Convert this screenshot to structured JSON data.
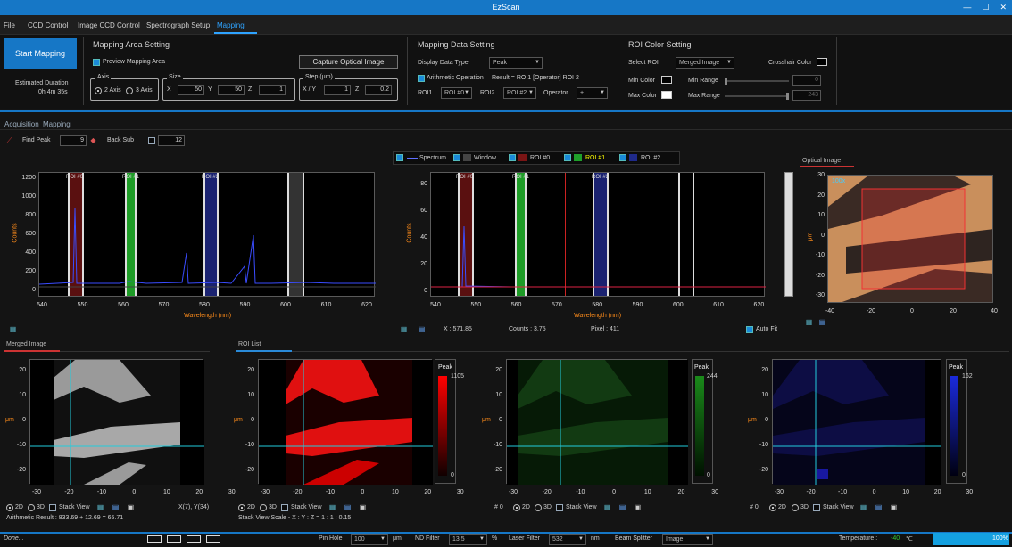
{
  "app": {
    "title": "EzScan",
    "win": {
      "min": "—",
      "max": "☐",
      "close": "✕"
    }
  },
  "menu": [
    "File",
    "CCD Control",
    "Image CCD Control",
    "Spectrograph Setup",
    "Mapping"
  ],
  "ribbon": {
    "start": "Start Mapping",
    "est_label": "Estimated Duration",
    "est_value": "0h 4m 35s",
    "area": {
      "title": "Mapping Area Setting",
      "preview": "Preview Mapping Area",
      "capture": "Capture Optical Image",
      "axis": "Axis",
      "two": "2 Axis",
      "three": "3 Axis",
      "size": "Size",
      "x": "X",
      "y": "Y",
      "z": "Z",
      "sx": "50",
      "sy": "50",
      "sz": "1",
      "step": "Step (μm)",
      "xy": "X / Y",
      "stxy": "1",
      "stz": "0.2"
    },
    "data": {
      "title": "Mapping Data Setting",
      "type_label": "Display Data Type",
      "type": "Peak",
      "arith": "Arithmetic Operation",
      "result": "Result = ROI1 [Operator] ROI 2",
      "roi1": "ROI1",
      "roi1v": "ROI #0",
      "roi2": "ROI2",
      "roi2v": "ROI #2",
      "op": "Operator",
      "opv": "+"
    },
    "color": {
      "title": "ROI Color Setting",
      "sel": "Select ROI",
      "selv": "Merged Image",
      "cross": "Crosshair Color",
      "min": "Min Color",
      "max": "Max Color",
      "minr": "Min Range",
      "minv": "0",
      "maxr": "Max Range",
      "maxv": "243"
    }
  },
  "tabs": {
    "acq": "Acquisition",
    "map": "Mapping"
  },
  "findpeak": {
    "label": "Find Peak",
    "value": "9",
    "back": "Back Sub",
    "back_value": "12"
  },
  "legend": [
    "Spectrum",
    "Window",
    "ROI #0",
    "ROI #1",
    "ROI #2"
  ],
  "colors": {
    "roi0": "#7a1515",
    "roi1": "#1fa02a",
    "roi2": "#1f2a8a",
    "accent": "#1677c6"
  },
  "spec": {
    "y_title": "Counts",
    "x_title": "Wavelength (nm)",
    "yticks": [
      "1200",
      "1000",
      "800",
      "600",
      "400",
      "200",
      "0"
    ],
    "xticks": [
      "540",
      "550",
      "560",
      "570",
      "580",
      "590",
      "600",
      "610",
      "620"
    ],
    "roi": [
      "ROI #0",
      "ROI #1",
      "ROI #2"
    ]
  },
  "spec2": {
    "yticks": [
      "80",
      "60",
      "40",
      "20",
      "0"
    ]
  },
  "readout": {
    "x": "X :  571.85",
    "counts": "Counts :  3.75",
    "pixel": "Pixel :  411",
    "autofit": "Auto Fit"
  },
  "optical": {
    "title": "Optical Image",
    "mag": "100x",
    "yticks": [
      "30",
      "20",
      "10",
      "0",
      "-10",
      "-20",
      "-30"
    ],
    "xticks": [
      "-40",
      "-20",
      "0",
      "20",
      "40"
    ],
    "unit": "μm"
  },
  "merged": {
    "title": "Merged Image",
    "coords": "X(7), Y(34)",
    "arith": "Arithmetic Result :   833.69  +  12.69  =  65.71"
  },
  "roilist": {
    "title": "ROI List",
    "scale": "Stack View Scale - X : Y : Z = 1 : 1 : 0.15"
  },
  "maps": {
    "yticks": [
      "20",
      "10",
      "0",
      "-10",
      "-20"
    ],
    "xticks": [
      "-30",
      "-20",
      "-10",
      "0",
      "10",
      "20",
      "30"
    ],
    "unit": "μm",
    "peak": "Peak",
    "max0": "1105",
    "max1": "244",
    "max2": "162",
    "zero": "0",
    "idx": "# 0",
    "d2": "2D",
    "d3": "3D",
    "stack": "Stack View"
  },
  "status": {
    "done": "Done...",
    "pinhole": "Pin Hole",
    "pinv": "100",
    "pinu": "μm",
    "nd": "ND Filter",
    "ndv": "13.5",
    "ndu": "%",
    "laser": "Laser Filter",
    "laserv": "532",
    "laseru": "nm",
    "beam": "Beam Splitter",
    "beamv": "Image",
    "temp": "Temperature :",
    "tempv": "-40",
    "tempu": "℃",
    "prog": "100%"
  }
}
